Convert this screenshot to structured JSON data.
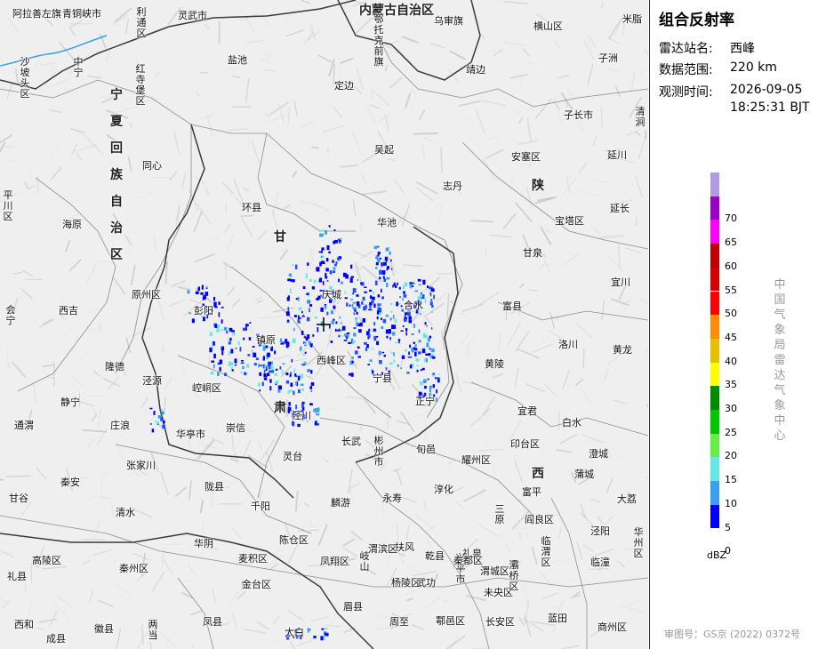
{
  "panel": {
    "title": "组合反射率",
    "rows": [
      {
        "label": "雷达站名:",
        "value": "西峰"
      },
      {
        "label": "数据范围:",
        "value": "220 km"
      },
      {
        "label": "观测时间:",
        "value": "2026-09-05"
      },
      {
        "label": "",
        "value": "18:25:31 BJT"
      }
    ],
    "legend_unit": "dBZ",
    "legend": [
      {
        "label": "",
        "color": "#b39ae6"
      },
      {
        "label": "70",
        "color": "#9b00c8"
      },
      {
        "label": "65",
        "color": "#ff00ff"
      },
      {
        "label": "60",
        "color": "#c00000"
      },
      {
        "label": "55",
        "color": "#d60000"
      },
      {
        "label": "50",
        "color": "#ff0000"
      },
      {
        "label": "45",
        "color": "#ff8c00"
      },
      {
        "label": "40",
        "color": "#e7c000"
      },
      {
        "label": "35",
        "color": "#ffff00"
      },
      {
        "label": "30",
        "color": "#008c00"
      },
      {
        "label": "25",
        "color": "#00c800"
      },
      {
        "label": "20",
        "color": "#66ee44"
      },
      {
        "label": "15",
        "color": "#66e8e8"
      },
      {
        "label": "10",
        "color": "#3c9ef0"
      },
      {
        "label": "5",
        "color": "#0000ff"
      },
      {
        "label": "0",
        "color": ""
      }
    ],
    "agency": "中国气象局雷达气象中心",
    "approval": "审图号：GS京 (2022) 0372号"
  },
  "map": {
    "provinces": [
      "宁夏回族自治区",
      "甘",
      "肃",
      "陕",
      "西",
      "内蒙古自治区"
    ],
    "places": [
      "阿拉善左旗",
      "青铜峡市",
      "利通区",
      "灵武市",
      "鄂托克前旗",
      "乌审旗",
      "米脂",
      "横山区",
      "沙坡头区",
      "中宁",
      "红寺堡区",
      "盐池",
      "靖边",
      "子洲",
      "定边",
      "子长市",
      "清涧",
      "吴起",
      "安塞区",
      "延川",
      "同心",
      "志丹",
      "海原",
      "环县",
      "华池",
      "宝塔区",
      "延长",
      "平川区",
      "甘泉",
      "原州区",
      "庆城",
      "合水",
      "宜川",
      "会宁",
      "西吉",
      "彭阳",
      "镇原",
      "富县",
      "西峰区",
      "洛川",
      "黄龙",
      "隆德",
      "泾源",
      "崆峒区",
      "宁县",
      "黄陵",
      "静宁",
      "正宁",
      "庄浪",
      "宜君",
      "白水",
      "华亭市",
      "崇信",
      "泾川",
      "通渭",
      "长武",
      "彬州市",
      "旬邑",
      "耀州区",
      "印台区",
      "澄城",
      "张家川",
      "灵台",
      "淳化",
      "富平",
      "蒲城",
      "甘谷",
      "秦安",
      "陇县",
      "麟游",
      "永寿",
      "三原",
      "阎良区",
      "大荔",
      "清水",
      "千阳",
      "临渭区",
      "临潼",
      "华州区",
      "华阴",
      "陈仓区",
      "凤翔区",
      "岐山",
      "扶风",
      "乾县",
      "礼泉",
      "泾阳",
      "高陵区",
      "秦州区",
      "麦积区",
      "金台区",
      "渭滨区",
      "杨陵区",
      "武功",
      "兴平市",
      "秦都区",
      "渭城区",
      "未央区",
      "灞桥区",
      "礼县",
      "西和",
      "徽县",
      "两当",
      "凤县",
      "太白",
      "眉县",
      "周至",
      "鄠邑区",
      "长安区",
      "蓝田",
      "商州区",
      "成县"
    ],
    "radar_station": "西峰"
  }
}
